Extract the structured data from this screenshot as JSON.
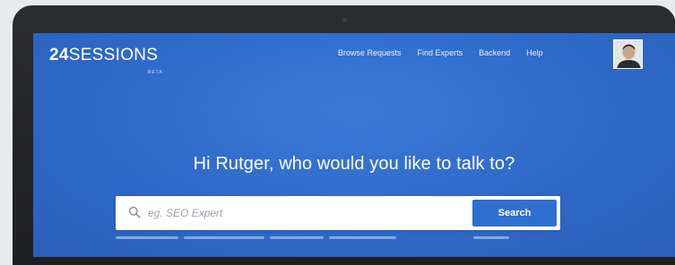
{
  "app": {
    "logo_number": "24",
    "logo_text": "SESSIONS",
    "logo_badge": "BETA"
  },
  "nav": {
    "items": [
      {
        "label": "Browse Requests"
      },
      {
        "label": "Find Experts"
      },
      {
        "label": "Backend"
      },
      {
        "label": "Help"
      }
    ]
  },
  "hero": {
    "greeting": "Hi Rutger, who would you like to talk to?"
  },
  "search": {
    "placeholder": "eg. SEO Expert",
    "value": "",
    "button_label": "Search"
  },
  "colors": {
    "background": "#2f69c8",
    "button": "#2f6fd0",
    "text": "#ffffff"
  }
}
